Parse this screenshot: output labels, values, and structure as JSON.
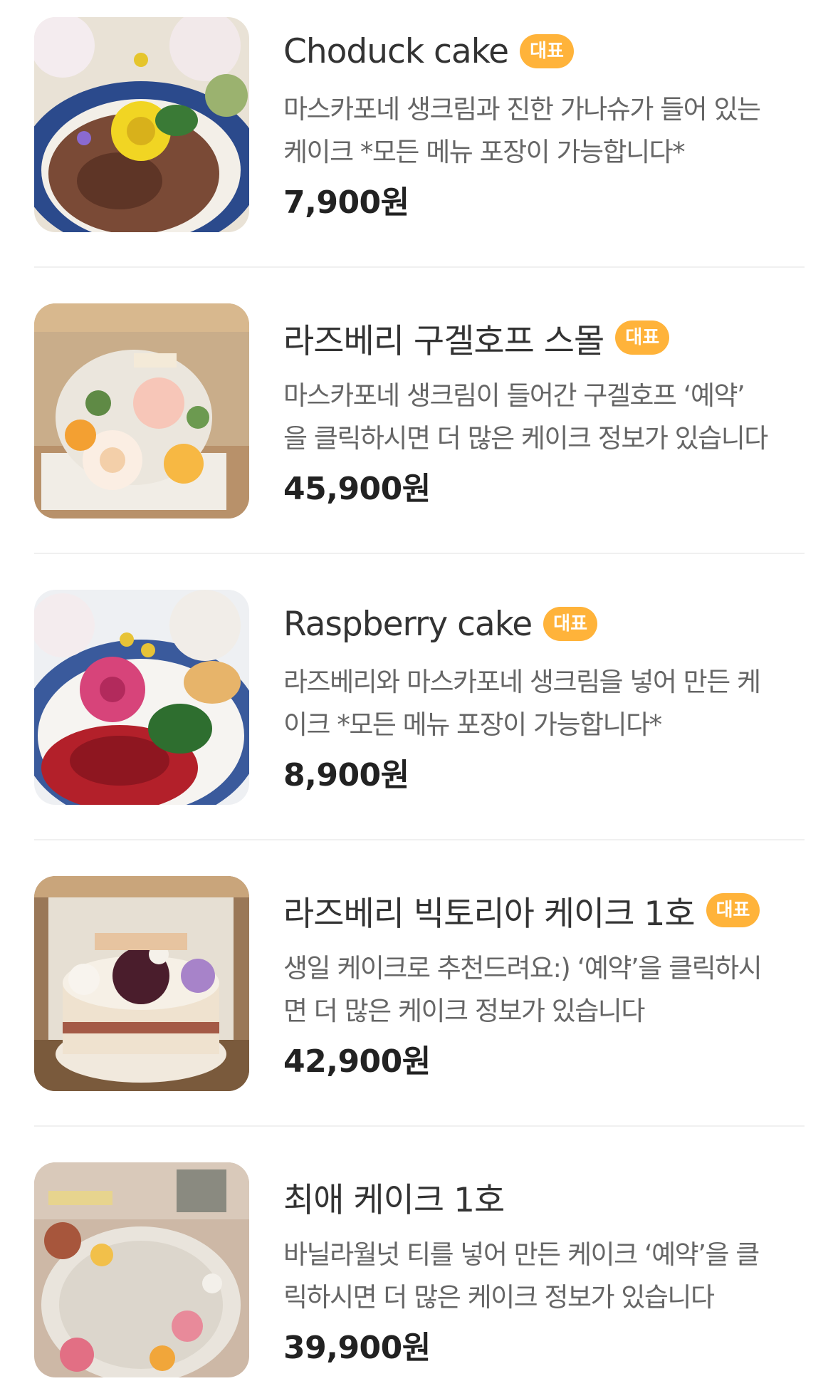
{
  "items": [
    {
      "name": "Choduck cake",
      "badge": "대표",
      "desc_line1": "마스카포네 생크림과 진한 가나슈가 들어 있는",
      "desc_line2": "케이크 *모든 메뉴 포장이 가능합니다*",
      "price": "7,900원"
    },
    {
      "name": "라즈베리 구겔호프 스몰",
      "badge": "대표",
      "desc_line1": "마스카포네 생크림이 들어간 구겔호프 ‘예약’",
      "desc_line2": "을 클릭하시면 더 많은 케이크 정보가 있습니다",
      "price": "45,900원"
    },
    {
      "name": "Raspberry cake",
      "badge": "대표",
      "desc_line1": "라즈베리와 마스카포네 생크림을 넣어 만든 케",
      "desc_line2": "이크 *모든 메뉴 포장이 가능합니다*",
      "price": "8,900원"
    },
    {
      "name": "라즈베리 빅토리아 케이크 1호",
      "badge": "대표",
      "desc_line1": "생일 케이크로 추천드려요:) ‘예약’을 클릭하시",
      "desc_line2": "면 더 많은 케이크 정보가 있습니다",
      "price": "42,900원"
    },
    {
      "name": "최애 케이크 1호",
      "badge": "",
      "desc_line1": "바닐라월넛 티를 넣어 만든 케이크 ‘예약’을 클",
      "desc_line2": "릭하시면 더 많은 케이크 정보가 있습니다",
      "price": "39,900원"
    }
  ],
  "colors": {
    "badge": "#ffb33a",
    "divider": "#f0f0f0"
  }
}
